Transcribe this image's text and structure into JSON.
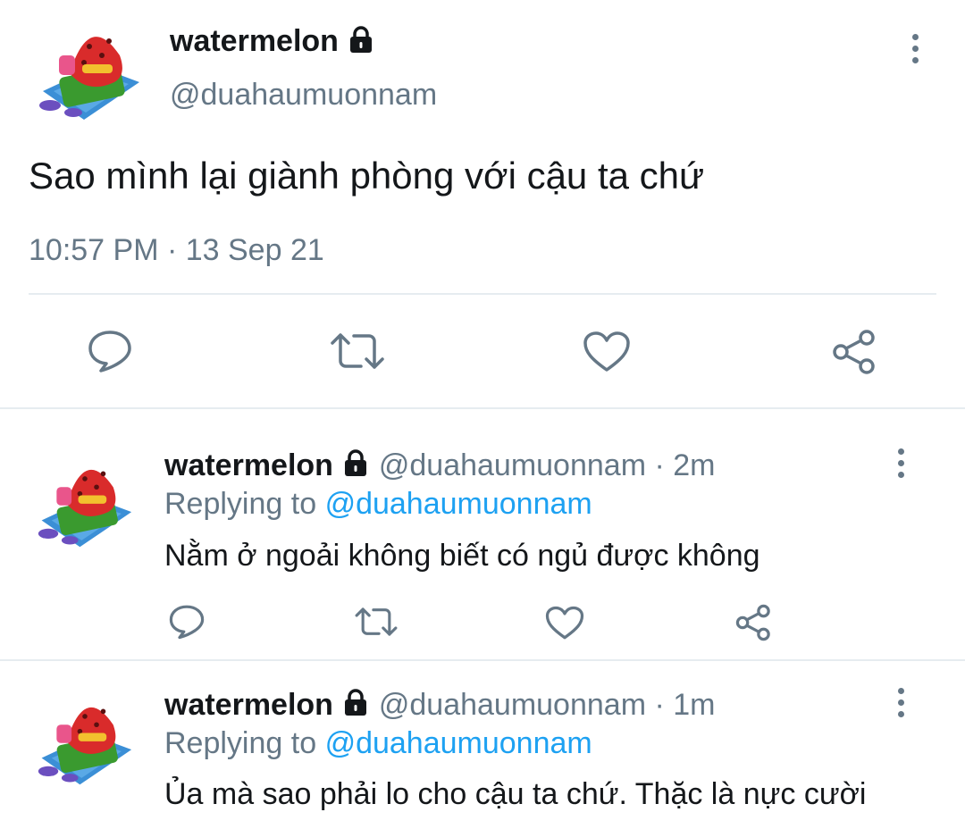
{
  "main_tweet": {
    "display_name": "watermelon",
    "handle": "@duahaumuonnam",
    "text": "Sao mình lại giành phòng với cậu ta chứ",
    "timestamp": "10:57 PM · 13 Sep 21",
    "protected": true
  },
  "replies": [
    {
      "display_name": "watermelon",
      "handle_time": "@duahaumuonnam · 2m",
      "replying_prefix": "Replying to",
      "replying_handle": "@duahaumuonnam",
      "text": "Nằm ở ngoải không biết có ngủ được không",
      "protected": true
    },
    {
      "display_name": "watermelon",
      "handle_time": "@duahaumuonnam · 1m",
      "replying_prefix": "Replying to",
      "replying_handle": "@duahaumuonnam",
      "text": "Ủa mà sao phải lo cho cậu ta chứ. Thặc là nực cười",
      "protected": true
    }
  ],
  "actions": [
    "reply-icon",
    "retweet-icon",
    "like-icon",
    "share-icon"
  ],
  "colors": {
    "text": "#14171a",
    "secondary": "#657786",
    "link": "#1da1f2",
    "divider": "#e6ecf0"
  }
}
